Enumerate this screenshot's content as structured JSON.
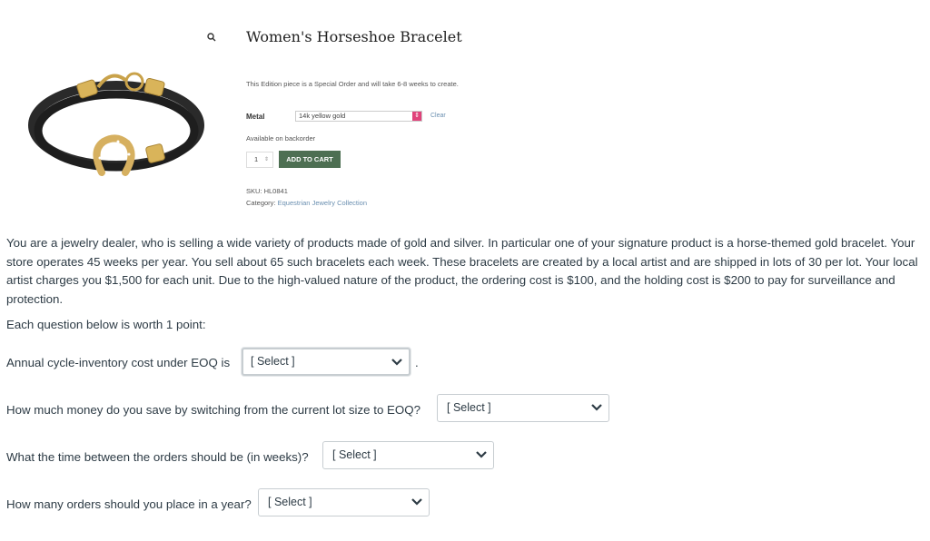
{
  "product": {
    "title": "Women's Horseshoe Bracelet",
    "description": "This Edition piece is a Special Order and will take 6-8 weeks to create.",
    "metal_label": "Metal",
    "metal_value": "14k yellow gold",
    "clear_label": "Clear",
    "availability": "Available on backorder",
    "quantity": "1",
    "add_to_cart": "ADD TO CART",
    "sku": "SKU: HL0841",
    "category_label": "Category:",
    "category_link": "Equestrian Jewelry Collection",
    "image_icon": "horseshoe-bracelet-image",
    "search_icon": "search-icon"
  },
  "question": {
    "intro": "You are a jewelry dealer, who is selling a wide variety of products made of gold and silver. In particular  one of your signature product is a horse-themed gold bracelet. Your store operates  45  weeks per year. You sell about 65 such bracelets each week. These bracelets are created by a local artist and are shipped in lots of 30 per lot. Your local artist charges you $1,500 for each unit. Due to the high-valued nature of the product, the ordering cost is $100, and the holding cost is $200 to pay for surveillance and protection.",
    "worth": "Each question below is worth 1 point:",
    "items": [
      {
        "text": "Annual cycle-inventory cost under EOQ is",
        "selected": "[ Select ]",
        "suffix": "."
      },
      {
        "text": "How much money do you save by switching from the current lot size to EOQ?",
        "selected": "[ Select ]"
      },
      {
        "text": "What the time between the orders should be (in weeks)?",
        "selected": "[ Select ]"
      },
      {
        "text": "How many orders should you place in a year?",
        "selected": "[ Select ]"
      }
    ]
  },
  "colors": {
    "cart_button": "#4d6f52",
    "select_arrow": "#e0427a",
    "link": "#6a8fb0",
    "text": "#2d3b45"
  }
}
